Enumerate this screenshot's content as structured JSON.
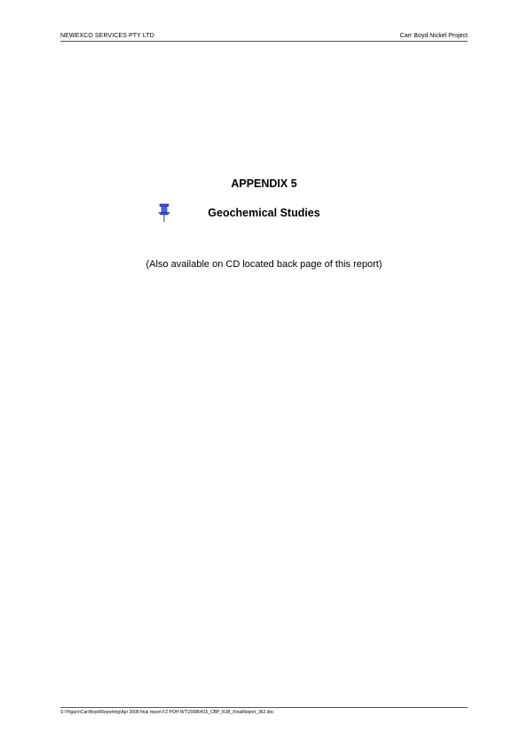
{
  "header": {
    "company": "NEWEXCO SERVICES PTY LTD",
    "project": "Carr Boyd Nickel Project"
  },
  "content": {
    "appendix_title": "APPENDIX 5",
    "section_title": "Geochemical Studies",
    "note": "(Also available on CD located back page of this report)",
    "icon": "pushpin-icon"
  },
  "footer": {
    "file_path": "S:\\Yilgarn\\CarrBoyd\\Reporting\\Apr 2008 final report FZ POH WT\\20080415_CBP_RJB_FinalReport_362.doc"
  },
  "colors": {
    "pin_blue": "#3a4fd6",
    "rule": "#555555"
  }
}
